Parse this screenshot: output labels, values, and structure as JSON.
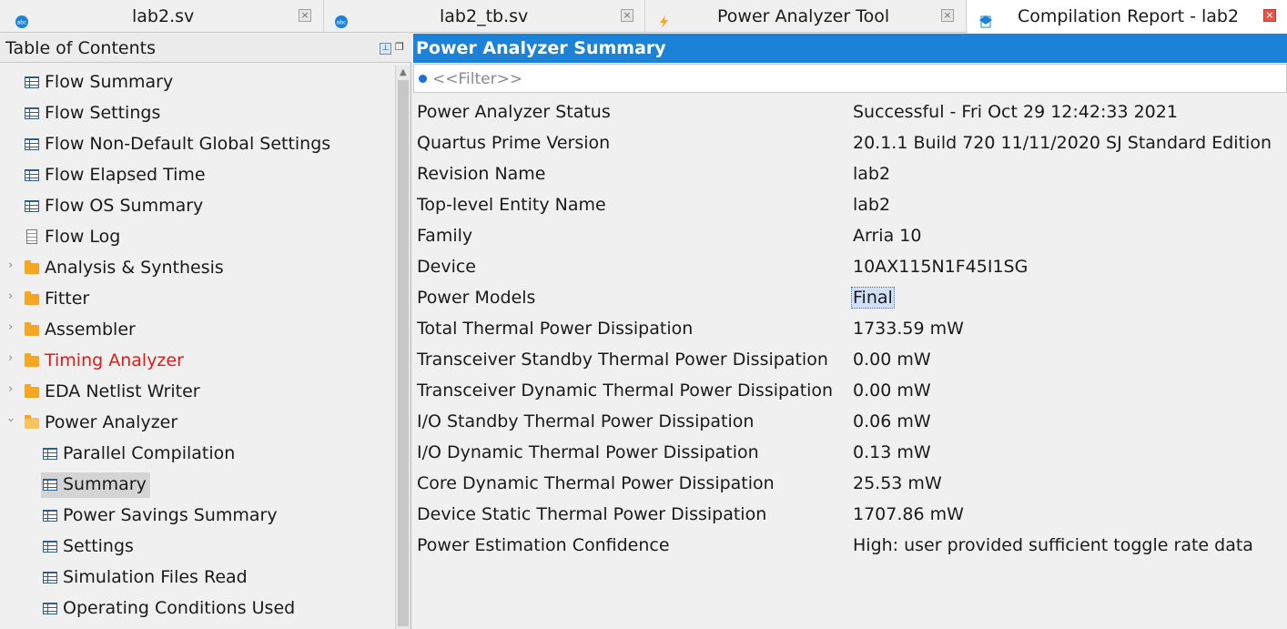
{
  "tabs": [
    {
      "label": "lab2.sv",
      "icon": "sv-file-icon",
      "close": "×"
    },
    {
      "label": "lab2_tb.sv",
      "icon": "sv-file-icon",
      "close": "×"
    },
    {
      "label": "Power Analyzer Tool",
      "icon": "lightning-icon",
      "close": "×"
    },
    {
      "label": "Compilation Report - lab2",
      "icon": "report-icon",
      "close": "×"
    }
  ],
  "toc": {
    "title": "Table of Contents",
    "items": [
      {
        "label": "Flow Summary",
        "icon": "table-icon"
      },
      {
        "label": "Flow Settings",
        "icon": "table-icon"
      },
      {
        "label": "Flow Non-Default Global Settings",
        "icon": "table-icon"
      },
      {
        "label": "Flow Elapsed Time",
        "icon": "table-icon"
      },
      {
        "label": "Flow OS Summary",
        "icon": "table-icon"
      },
      {
        "label": "Flow Log",
        "icon": "document-icon"
      },
      {
        "label": "Analysis & Synthesis",
        "icon": "folder-icon"
      },
      {
        "label": "Fitter",
        "icon": "folder-icon"
      },
      {
        "label": "Assembler",
        "icon": "folder-icon"
      },
      {
        "label": "Timing Analyzer",
        "icon": "folder-icon",
        "color": "#e01a1a"
      },
      {
        "label": "EDA Netlist Writer",
        "icon": "folder-icon"
      },
      {
        "label": "Power Analyzer",
        "icon": "folder-open-icon",
        "expanded": true
      },
      {
        "label": "Parallel Compilation",
        "icon": "table-icon"
      },
      {
        "label": "Summary",
        "icon": "table-icon",
        "selected": true
      },
      {
        "label": "Power Savings Summary",
        "icon": "table-icon"
      },
      {
        "label": "Settings",
        "icon": "table-icon"
      },
      {
        "label": "Simulation Files Read",
        "icon": "table-icon"
      },
      {
        "label": "Operating Conditions Used",
        "icon": "table-icon"
      }
    ]
  },
  "summary": {
    "title": "Power Analyzer Summary",
    "filter_placeholder": "<<Filter>>",
    "rows": [
      {
        "key": "Power Analyzer Status",
        "value": "Successful - Fri Oct 29 12:42:33 2021"
      },
      {
        "key": "Quartus Prime Version",
        "value": "20.1.1 Build 720 11/11/2020 SJ Standard Edition"
      },
      {
        "key": "Revision Name",
        "value": "lab2"
      },
      {
        "key": "Top-level Entity Name",
        "value": "lab2"
      },
      {
        "key": "Family",
        "value": "Arria 10"
      },
      {
        "key": "Device",
        "value": "10AX115N1F45I1SG"
      },
      {
        "key": "Power Models",
        "value": "Final",
        "selected": true
      },
      {
        "key": "Total Thermal Power Dissipation",
        "value": "1733.59 mW"
      },
      {
        "key": "Transceiver Standby Thermal Power Dissipation",
        "value": "0.00 mW"
      },
      {
        "key": "Transceiver Dynamic Thermal Power Dissipation",
        "value": "0.00 mW"
      },
      {
        "key": "I/O Standby Thermal Power Dissipation",
        "value": "0.06 mW"
      },
      {
        "key": "I/O Dynamic Thermal Power Dissipation",
        "value": "0.13 mW"
      },
      {
        "key": "Core Dynamic Thermal Power Dissipation",
        "value": "25.53 mW"
      },
      {
        "key": "Device Static Thermal Power Dissipation",
        "value": "1707.86 mW"
      },
      {
        "key": "Power Estimation Confidence",
        "value": "High: user provided sufficient toggle rate data"
      }
    ]
  }
}
